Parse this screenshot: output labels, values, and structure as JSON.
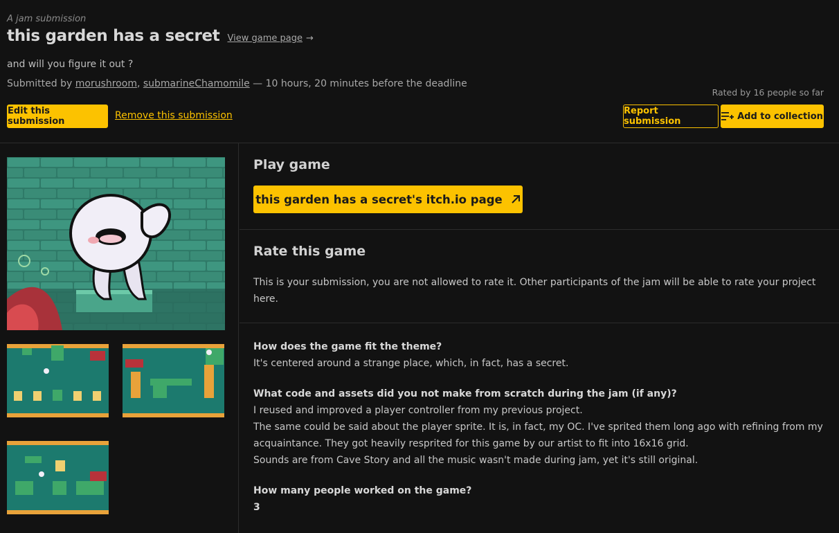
{
  "header": {
    "kicker": "A jam submission",
    "title": "this garden has a secret",
    "view_link": "View game page",
    "view_arrow": "→",
    "tagline": "and will you figure it out ?",
    "submitted_prefix": "Submitted by ",
    "author1": "morushroom",
    "comma": ", ",
    "author2": "submarineChamomile",
    "submitted_suffix": " — 10 hours, 20 minutes before the deadline",
    "rated": "Rated by 16 people so far",
    "edit_button": "Edit this submission",
    "remove_link": "Remove this submission",
    "report_button": "Report submission",
    "collection_button": "Add to collection"
  },
  "play": {
    "heading": "Play game",
    "button": "this garden has a secret's itch.io page"
  },
  "rate": {
    "heading": "Rate this game",
    "text": "This is your submission, you are not allowed to rate it. Other participants of the jam will be able to rate your project here."
  },
  "qa": {
    "q1": "How does the game fit the theme?",
    "a1": "It's centered around a strange place, which, in fact, has a secret.",
    "q2": "What code and assets did you not make from scratch during the jam (if any)?",
    "a2_l1": "I reused and improved a player controller from my previous project.",
    "a2_l2": "The same could be said about the player sprite. It is, in fact, my OC. I've sprited them long ago with refining from my acquaintance. They got heavily resprited for this game by our artist to fit into 16x16 grid.",
    "a2_l3": "Sounds are from Cave Story and all the music wasn't made during jam, yet it's still original.",
    "q3": "How many people worked on the game?",
    "a3": "3"
  },
  "colors": {
    "accent": "#fcc200",
    "background": "#121212",
    "text": "#cfcfcf"
  }
}
